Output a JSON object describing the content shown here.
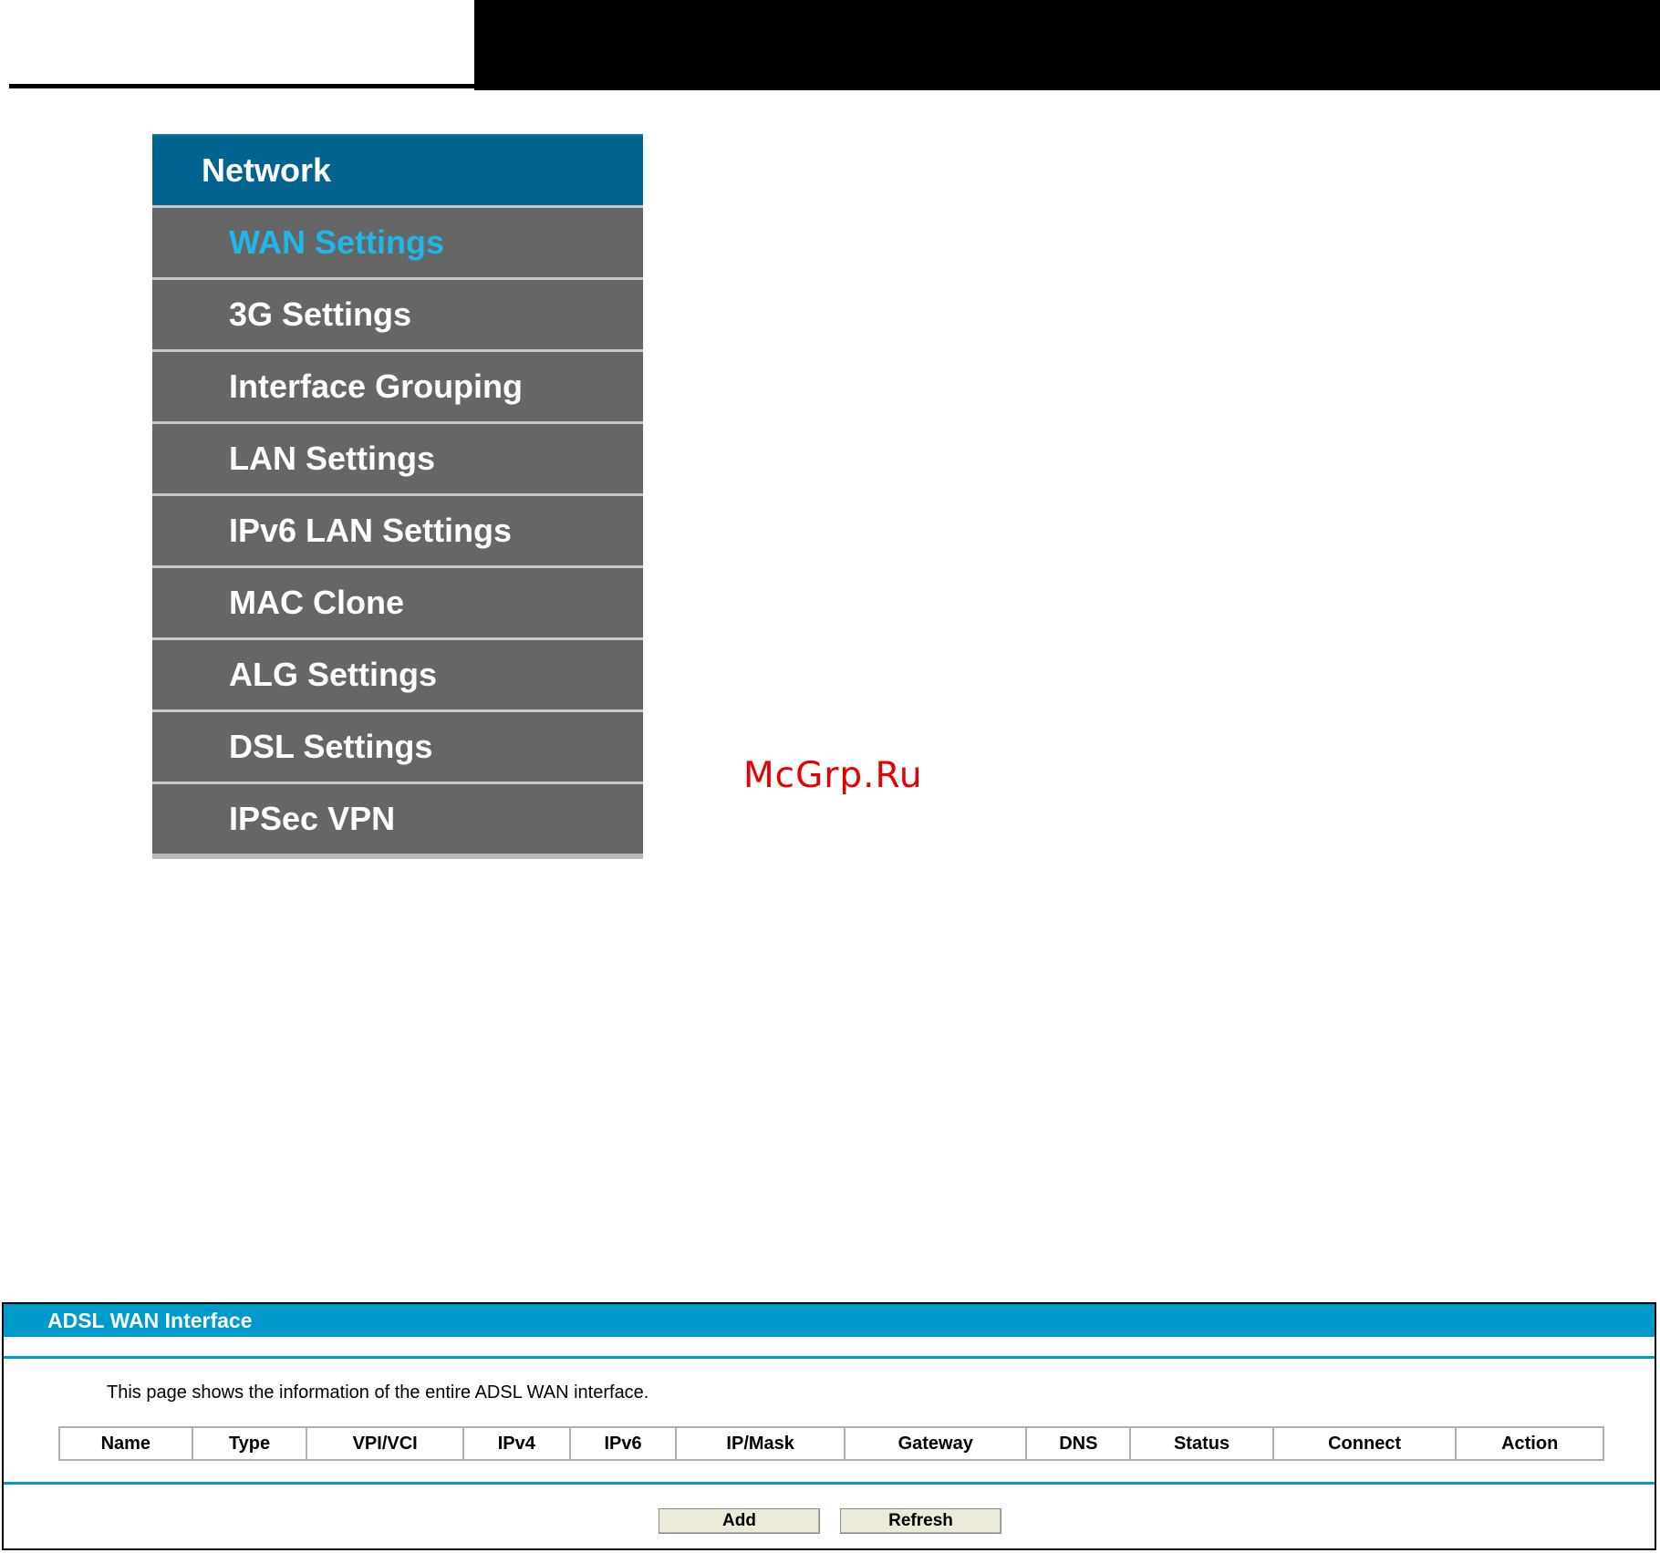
{
  "menu": {
    "title": "Network",
    "items": [
      {
        "label": "WAN Settings",
        "active": true
      },
      {
        "label": "3G Settings"
      },
      {
        "label": "Interface Grouping"
      },
      {
        "label": "LAN Settings"
      },
      {
        "label": "IPv6 LAN Settings"
      },
      {
        "label": "MAC Clone"
      },
      {
        "label": "ALG Settings"
      },
      {
        "label": "DSL Settings"
      },
      {
        "label": "IPSec VPN"
      }
    ]
  },
  "watermark": "McGrp.Ru",
  "adsl": {
    "title": "ADSL WAN Interface",
    "description": "This page shows the information of the entire ADSL WAN interface.",
    "columns": [
      "Name",
      "Type",
      "VPI/VCI",
      "IPv4",
      "IPv6",
      "IP/Mask",
      "Gateway",
      "DNS",
      "Status",
      "Connect",
      "Action"
    ],
    "add_label": "Add",
    "refresh_label": "Refresh"
  },
  "colors": {
    "menu_header": "#006390",
    "menu_item": "#666666",
    "menu_active_text": "#1fb6ea",
    "panel_accent": "#0099cc",
    "watermark": "#e60000"
  }
}
